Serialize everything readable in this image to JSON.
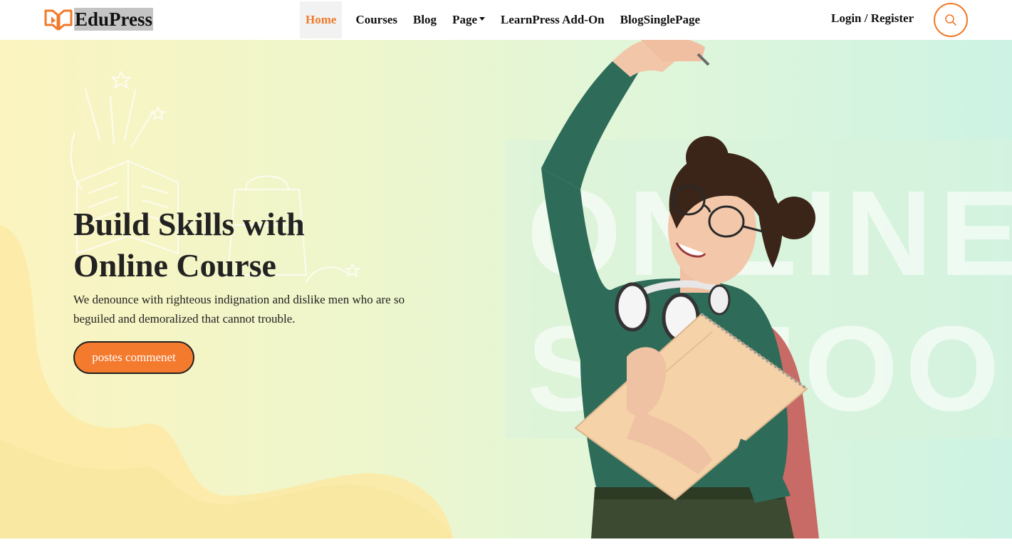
{
  "brand": {
    "name": "EduPress",
    "accent": "#f07a2a"
  },
  "nav": {
    "items": [
      {
        "label": "Home",
        "active": true
      },
      {
        "label": "Courses",
        "active": false
      },
      {
        "label": "Blog",
        "active": false
      },
      {
        "label": "Page",
        "active": false,
        "dropdown": true
      },
      {
        "label": "LearnPress Add-On",
        "active": false
      },
      {
        "label": "BlogSinglePage",
        "active": false
      }
    ],
    "login": "Login / Register",
    "search_icon": "search-icon"
  },
  "hero": {
    "title_line1": "Build Skills with",
    "title_line2": "Online Course",
    "description": "We denounce with righteous indignation and dislike men who are so beguiled and demoralized that cannot trouble.",
    "button": "postes commenet",
    "button_color": "#f47a2e",
    "bg_word1": "ONLINE",
    "bg_word2": "SCHOOL"
  }
}
